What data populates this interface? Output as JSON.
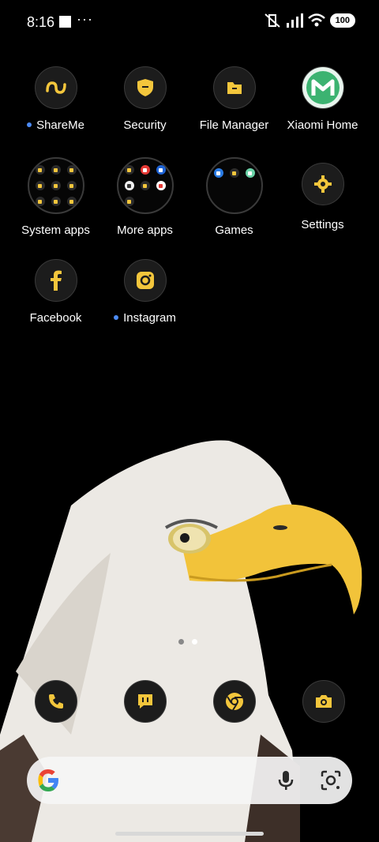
{
  "status": {
    "time": "8:16",
    "battery": "100"
  },
  "apps": [
    {
      "label": "ShareMe",
      "new": true
    },
    {
      "label": "Security",
      "new": false
    },
    {
      "label": "File Manager",
      "new": false
    },
    {
      "label": "Xiaomi Home",
      "new": false
    },
    {
      "label": "System apps",
      "new": false
    },
    {
      "label": "More apps",
      "new": false
    },
    {
      "label": "Games",
      "new": false
    },
    {
      "label": "Settings",
      "new": false
    },
    {
      "label": "Facebook",
      "new": false
    },
    {
      "label": "Instagram",
      "new": true
    }
  ],
  "dock": [
    "phone-icon",
    "messages-icon",
    "chrome-icon",
    "camera-icon"
  ],
  "colors": {
    "accent": "#f3c63c",
    "icon_bg": "#1c1c1c",
    "new_dot": "#4c8bf5"
  },
  "pages": {
    "current": 2,
    "total": 2
  }
}
